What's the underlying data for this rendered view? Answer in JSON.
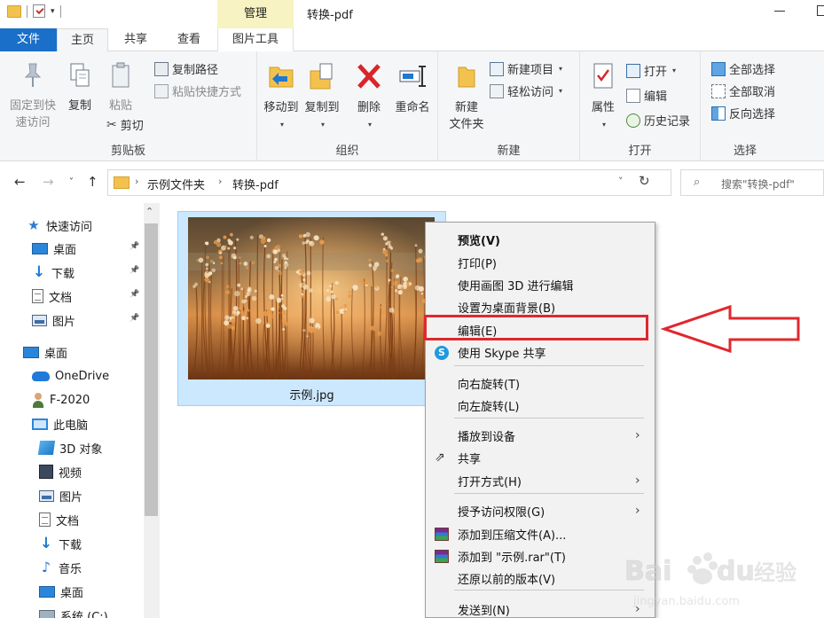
{
  "titlebar": {
    "manage_tab": "管理",
    "title": "转换-pdf"
  },
  "tabs": {
    "file": "文件",
    "home": "主页",
    "share": "共享",
    "view": "查看",
    "pictools": "图片工具"
  },
  "ribbon": {
    "clipboard": {
      "pin": "固定到快\n速访问",
      "pin_l1": "固定到快",
      "pin_l2": "速访问",
      "copy": "复制",
      "paste": "粘贴",
      "copy_path": "复制路径",
      "paste_shortcut": "粘贴快捷方式",
      "cut": "剪切",
      "label": "剪贴板"
    },
    "organize": {
      "move_to": "移动到",
      "copy_to": "复制到",
      "delete": "删除",
      "rename": "重命名",
      "label": "组织"
    },
    "new": {
      "new_folder_l1": "新建",
      "new_folder_l2": "文件夹",
      "new_item": "新建项目",
      "easy_access": "轻松访问",
      "label": "新建"
    },
    "open": {
      "properties": "属性",
      "open": "打开",
      "edit": "编辑",
      "history": "历史记录",
      "label": "打开"
    },
    "select": {
      "select_all": "全部选择",
      "select_none": "全部取消",
      "invert": "反向选择",
      "label": "选择"
    }
  },
  "address": {
    "crumbs": [
      "示例文件夹",
      "转换-pdf"
    ],
    "search_placeholder": "搜索\"转换-pdf\""
  },
  "navpane": {
    "items": [
      {
        "label": "快速访问",
        "icon": "star-icon",
        "pinned": false
      },
      {
        "label": "桌面",
        "icon": "desktop-icon",
        "pinned": true
      },
      {
        "label": "下载",
        "icon": "download-icon",
        "pinned": true
      },
      {
        "label": "文档",
        "icon": "document-icon",
        "pinned": true
      },
      {
        "label": "图片",
        "icon": "pictures-icon",
        "pinned": true
      },
      {
        "label": "桌面",
        "icon": "desktop-icon",
        "pinned": false
      },
      {
        "label": "OneDrive",
        "icon": "cloud-icon",
        "pinned": false
      },
      {
        "label": "F-2020",
        "icon": "user-icon",
        "pinned": false
      },
      {
        "label": "此电脑",
        "icon": "pc-icon",
        "pinned": false
      },
      {
        "label": "3D 对象",
        "icon": "3d-objects-icon",
        "pinned": false
      },
      {
        "label": "视频",
        "icon": "video-icon",
        "pinned": false
      },
      {
        "label": "图片",
        "icon": "pictures-icon",
        "pinned": false
      },
      {
        "label": "文档",
        "icon": "document-icon",
        "pinned": false
      },
      {
        "label": "下载",
        "icon": "download-icon",
        "pinned": false
      },
      {
        "label": "音乐",
        "icon": "music-icon",
        "pinned": false
      },
      {
        "label": "桌面",
        "icon": "desktop-icon",
        "pinned": false
      },
      {
        "label": "系统 (C:)",
        "icon": "drive-icon",
        "pinned": false
      }
    ]
  },
  "file": {
    "name": "示例.jpg"
  },
  "context_menu": {
    "items": [
      {
        "label": "预览(V)",
        "bold": true
      },
      {
        "label": "打印(P)"
      },
      {
        "label": "使用画图 3D 进行编辑"
      },
      {
        "label": "设置为桌面背景(B)"
      },
      {
        "label": "编辑(E)",
        "highlighted": true
      },
      {
        "label": "使用 Skype 共享",
        "icon": "skype-icon"
      },
      {
        "label": "向右旋转(T)"
      },
      {
        "label": "向左旋转(L)"
      },
      {
        "label": "播放到设备",
        "submenu": true
      },
      {
        "label": "共享",
        "icon": "share-icon"
      },
      {
        "label": "打开方式(H)",
        "submenu": true
      },
      {
        "label": "授予访问权限(G)",
        "submenu": true
      },
      {
        "label": "添加到压缩文件(A)...",
        "icon": "winrar-icon"
      },
      {
        "label": "添加到 \"示例.rar\"(T)",
        "icon": "winrar-icon"
      },
      {
        "label": "还原以前的版本(V)"
      },
      {
        "label": "发送到(N)",
        "submenu": true
      }
    ]
  },
  "annotation": {
    "highlight_color": "#e0282e",
    "arrow_color": "#e0282e"
  },
  "watermark": {
    "brand": "Baidu经验",
    "url": "jingyan.baidu.com"
  },
  "colors": {
    "file_tab": "#1a6fc9",
    "manage_tab": "#f7f3c2",
    "selection": "#cce8ff"
  }
}
